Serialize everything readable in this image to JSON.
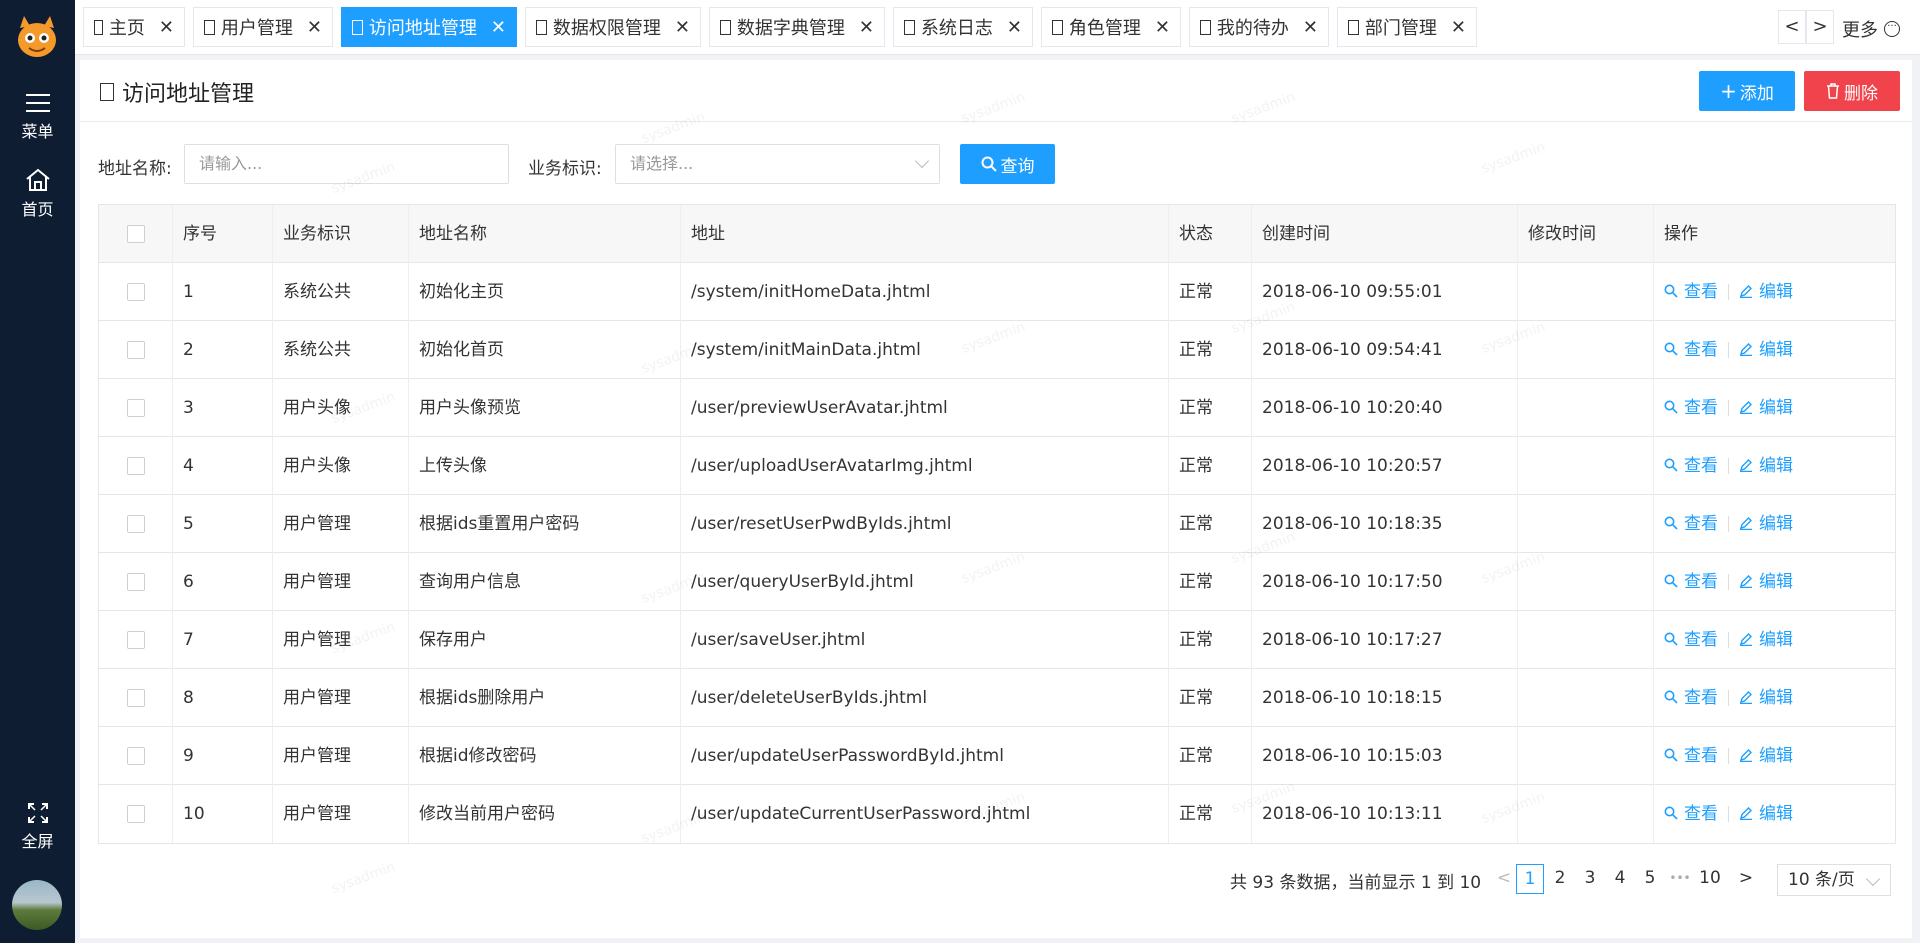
{
  "sidebar": {
    "menu_label": "菜单",
    "home_label": "首页",
    "fullscreen_label": "全屏"
  },
  "tabs": [
    {
      "label": "主页",
      "active": false
    },
    {
      "label": "用户管理",
      "active": false
    },
    {
      "label": "访问地址管理",
      "active": true
    },
    {
      "label": "数据权限管理",
      "active": false
    },
    {
      "label": "数据字典管理",
      "active": false
    },
    {
      "label": "系统日志",
      "active": false
    },
    {
      "label": "角色管理",
      "active": false
    },
    {
      "label": "我的待办",
      "active": false
    },
    {
      "label": "部门管理",
      "active": false
    }
  ],
  "tabbar": {
    "prev": "<",
    "next": ">",
    "more_label": "更多"
  },
  "page": {
    "title": "访问地址管理",
    "add_label": "添加",
    "delete_label": "删除"
  },
  "search": {
    "name_label": "地址名称:",
    "name_placeholder": "请输入...",
    "biz_label": "业务标识:",
    "biz_placeholder": "请选择...",
    "query_label": "查询"
  },
  "table": {
    "columns": [
      "序号",
      "业务标识",
      "地址名称",
      "地址",
      "状态",
      "创建时间",
      "修改时间",
      "操作"
    ],
    "view_label": "查看",
    "edit_label": "编辑",
    "rows": [
      {
        "no": "1",
        "biz": "系统公共",
        "name": "初始化主页",
        "url": "/system/initHomeData.jhtml",
        "status": "正常",
        "created": "2018-06-10 09:55:01",
        "modified": ""
      },
      {
        "no": "2",
        "biz": "系统公共",
        "name": "初始化首页",
        "url": "/system/initMainData.jhtml",
        "status": "正常",
        "created": "2018-06-10 09:54:41",
        "modified": ""
      },
      {
        "no": "3",
        "biz": "用户头像",
        "name": "用户头像预览",
        "url": "/user/previewUserAvatar.jhtml",
        "status": "正常",
        "created": "2018-06-10 10:20:40",
        "modified": ""
      },
      {
        "no": "4",
        "biz": "用户头像",
        "name": "上传头像",
        "url": "/user/uploadUserAvatarImg.jhtml",
        "status": "正常",
        "created": "2018-06-10 10:20:57",
        "modified": ""
      },
      {
        "no": "5",
        "biz": "用户管理",
        "name": "根据ids重置用户密码",
        "url": "/user/resetUserPwdByIds.jhtml",
        "status": "正常",
        "created": "2018-06-10 10:18:35",
        "modified": ""
      },
      {
        "no": "6",
        "biz": "用户管理",
        "name": "查询用户信息",
        "url": "/user/queryUserById.jhtml",
        "status": "正常",
        "created": "2018-06-10 10:17:50",
        "modified": ""
      },
      {
        "no": "7",
        "biz": "用户管理",
        "name": "保存用户",
        "url": "/user/saveUser.jhtml",
        "status": "正常",
        "created": "2018-06-10 10:17:27",
        "modified": ""
      },
      {
        "no": "8",
        "biz": "用户管理",
        "name": "根据ids删除用户",
        "url": "/user/deleteUserByIds.jhtml",
        "status": "正常",
        "created": "2018-06-10 10:18:15",
        "modified": ""
      },
      {
        "no": "9",
        "biz": "用户管理",
        "name": "根据id修改密码",
        "url": "/user/updateUserPasswordById.jhtml",
        "status": "正常",
        "created": "2018-06-10 10:15:03",
        "modified": ""
      },
      {
        "no": "10",
        "biz": "用户管理",
        "name": "修改当前用户密码",
        "url": "/user/updateCurrentUserPassword.jhtml",
        "status": "正常",
        "created": "2018-06-10 10:13:11",
        "modified": ""
      }
    ]
  },
  "pagination": {
    "summary": "共 93 条数据，当前显示 1 到 10",
    "prev": "<",
    "pages": [
      "1",
      "2",
      "3",
      "4",
      "5"
    ],
    "ellipsis": "•••",
    "last": "10",
    "next": ">",
    "page_size": "10 条/页"
  },
  "watermark_text": "sysadmin",
  "colors": {
    "primary": "#1e9fff",
    "danger": "#f0434b",
    "sidebar": "#0f1d33"
  }
}
